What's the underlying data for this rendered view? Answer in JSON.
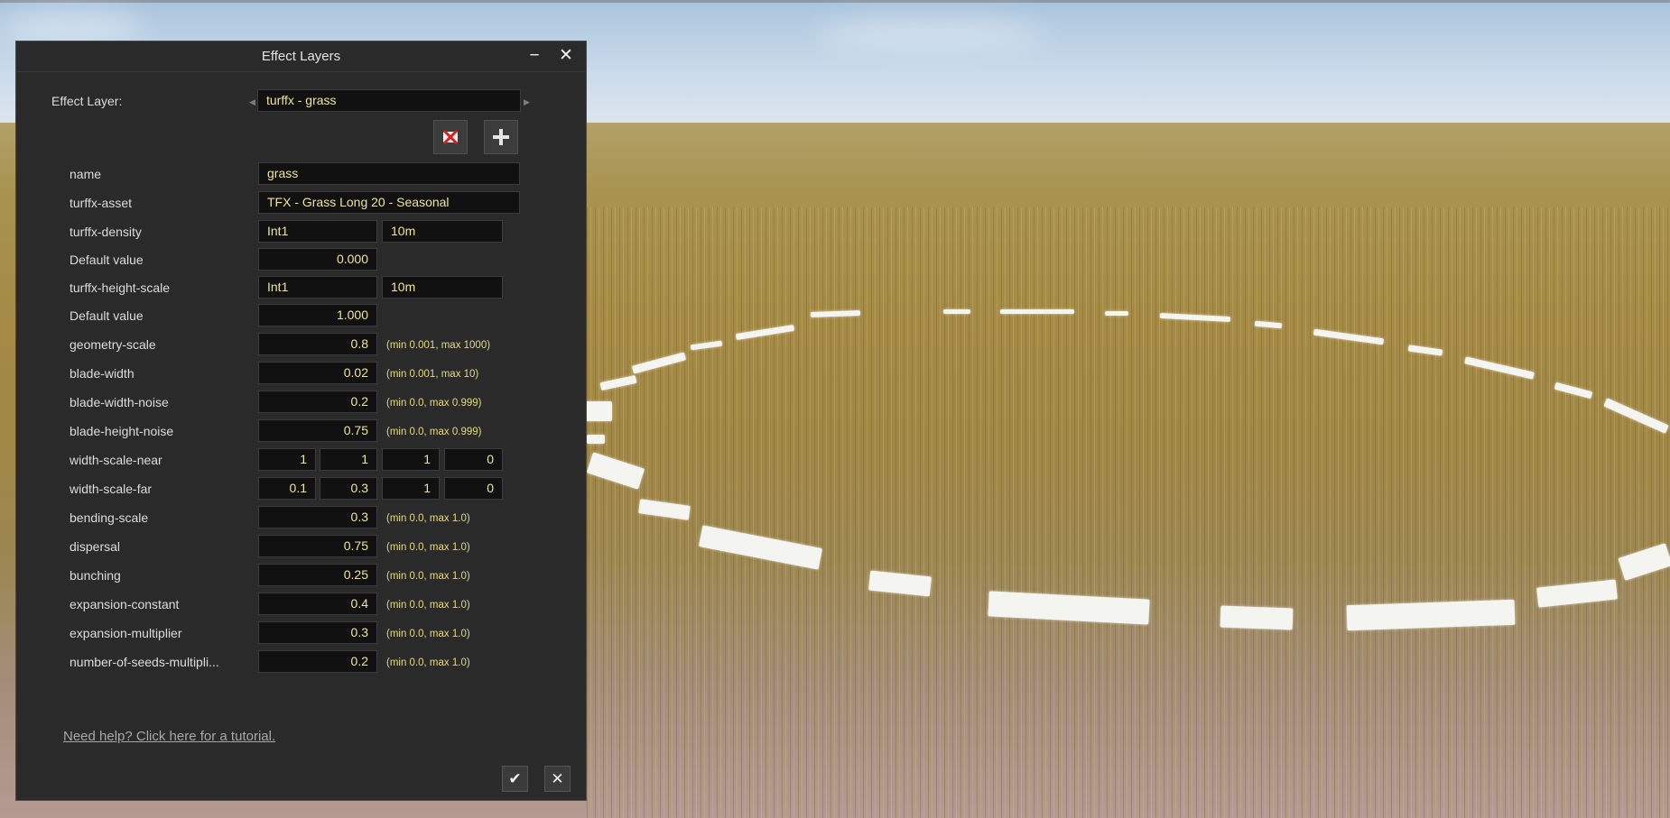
{
  "window": {
    "title": "Effect Layers",
    "minimize_icon": "minimize-icon",
    "close_icon": "close-icon"
  },
  "effect_layer": {
    "label": "Effect Layer:",
    "selected": "turffx - grass",
    "delete_icon": "delete-layer-icon",
    "add_icon": "add-layer-icon"
  },
  "properties": {
    "name": {
      "label": "name",
      "value": "grass"
    },
    "asset": {
      "label": "turffx-asset",
      "value": "TFX - Grass Long 20 - Seasonal"
    },
    "density": {
      "label": "turffx-density",
      "channel": "Int1",
      "scale": "10m"
    },
    "density_default": {
      "label": "Default value",
      "value": "0.000"
    },
    "height_scale": {
      "label": "turffx-height-scale",
      "channel": "Int1",
      "scale": "10m"
    },
    "height_default": {
      "label": "Default value",
      "value": "1.000"
    },
    "geometry_scale": {
      "label": "geometry-scale",
      "value": "0.8",
      "range": "(min 0.001, max 1000)"
    },
    "blade_width": {
      "label": "blade-width",
      "value": "0.02",
      "range": "(min 0.001, max 10)"
    },
    "blade_width_noise": {
      "label": "blade-width-noise",
      "value": "0.2",
      "range": "(min 0.0, max 0.999)"
    },
    "blade_height_noise": {
      "label": "blade-height-noise",
      "value": "0.75",
      "range": "(min 0.0, max 0.999)"
    },
    "width_scale_near": {
      "label": "width-scale-near",
      "values": [
        "1",
        "1",
        "1",
        "0"
      ]
    },
    "width_scale_far": {
      "label": "width-scale-far",
      "values": [
        "0.1",
        "0.3",
        "1",
        "0"
      ]
    },
    "bending_scale": {
      "label": "bending-scale",
      "value": "0.3",
      "range": "(min 0.0, max 1.0)"
    },
    "dispersal": {
      "label": "dispersal",
      "value": "0.75",
      "range": "(min 0.0, max 1.0)"
    },
    "bunching": {
      "label": "bunching",
      "value": "0.25",
      "range": "(min 0.0, max 1.0)"
    },
    "expansion_constant": {
      "label": "expansion-constant",
      "value": "0.4",
      "range": "(min 0.0, max 1.0)"
    },
    "expansion_multiplier": {
      "label": "expansion-multiplier",
      "value": "0.3",
      "range": "(min 0.0, max 1.0)"
    },
    "seeds_multiplier": {
      "label": "number-of-seeds-multipli...",
      "value": "0.2",
      "range": "(min 0.0, max 1.0)"
    }
  },
  "footer": {
    "help_link": "Need help? Click here for a tutorial.",
    "ok_icon": "checkmark-icon",
    "cancel_icon": "close-icon"
  }
}
